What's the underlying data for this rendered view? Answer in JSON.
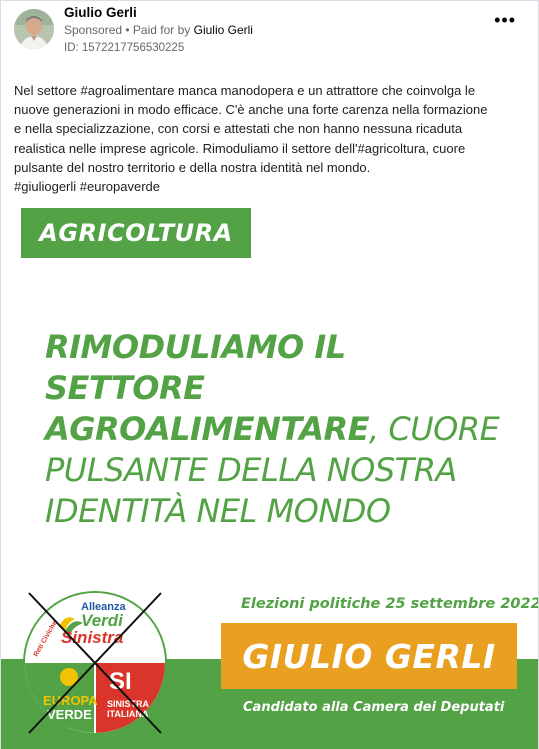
{
  "post": {
    "author": "Giulio Gerli",
    "sponsored": "Sponsored",
    "separator": " • ",
    "paid_for_by": "Paid for by ",
    "sponsor": "Giulio Gerli",
    "ad_id": "ID: 1572217756530225",
    "more_icon": "more-horizontal-icon",
    "more_glyph": "•••",
    "text_lines": [
      "Nel settore #agroalimentare manca manodopera e un attrattore che coinvolga le",
      "nuove generazioni in modo efficace. C'è anche una forte carenza nella formazione",
      "e nella specializzazione, con corsi e attestati che non hanno nessuna ricaduta",
      "realistica nelle imprese agricole. Rimoduliamo il settore dell'#agricoltura, cuore",
      "pulsante del nostro territorio e della nostra identità nel mondo.",
      "#giuliogerli #europaverde"
    ]
  },
  "creative": {
    "section_label": "AGRICOLTURA",
    "headline": {
      "bold_1": "RIMODULIAMO IL SETTORE",
      "bold_2": "AGROALIMENTARE",
      "light_2": ", CUORE",
      "light_3": "PULSANTE DELLA NOSTRA",
      "light_4": "IDENTITÀ NEL MONDO"
    },
    "election_date": "Elezioni politiche 25 settembre 2022",
    "candidate_name": "GIULIO GERLI",
    "candidate_role": "Candidato alla Camera dei Deputati",
    "logo": {
      "alleanza": "Alleanza",
      "verdi": "Verdi",
      "sinistra": "Sinistra",
      "reti_civiche": "Reti Civiche",
      "europa": "EUROPA",
      "verde": "VERDE",
      "si": "SI",
      "sinistra_small": "SINISTRA",
      "italiana": "ITALIANA"
    },
    "colors": {
      "brand_green": "#53a246",
      "name_orange": "#e9a020",
      "logo_red": "#d9352a",
      "logo_yellow": "#f2c300"
    }
  }
}
